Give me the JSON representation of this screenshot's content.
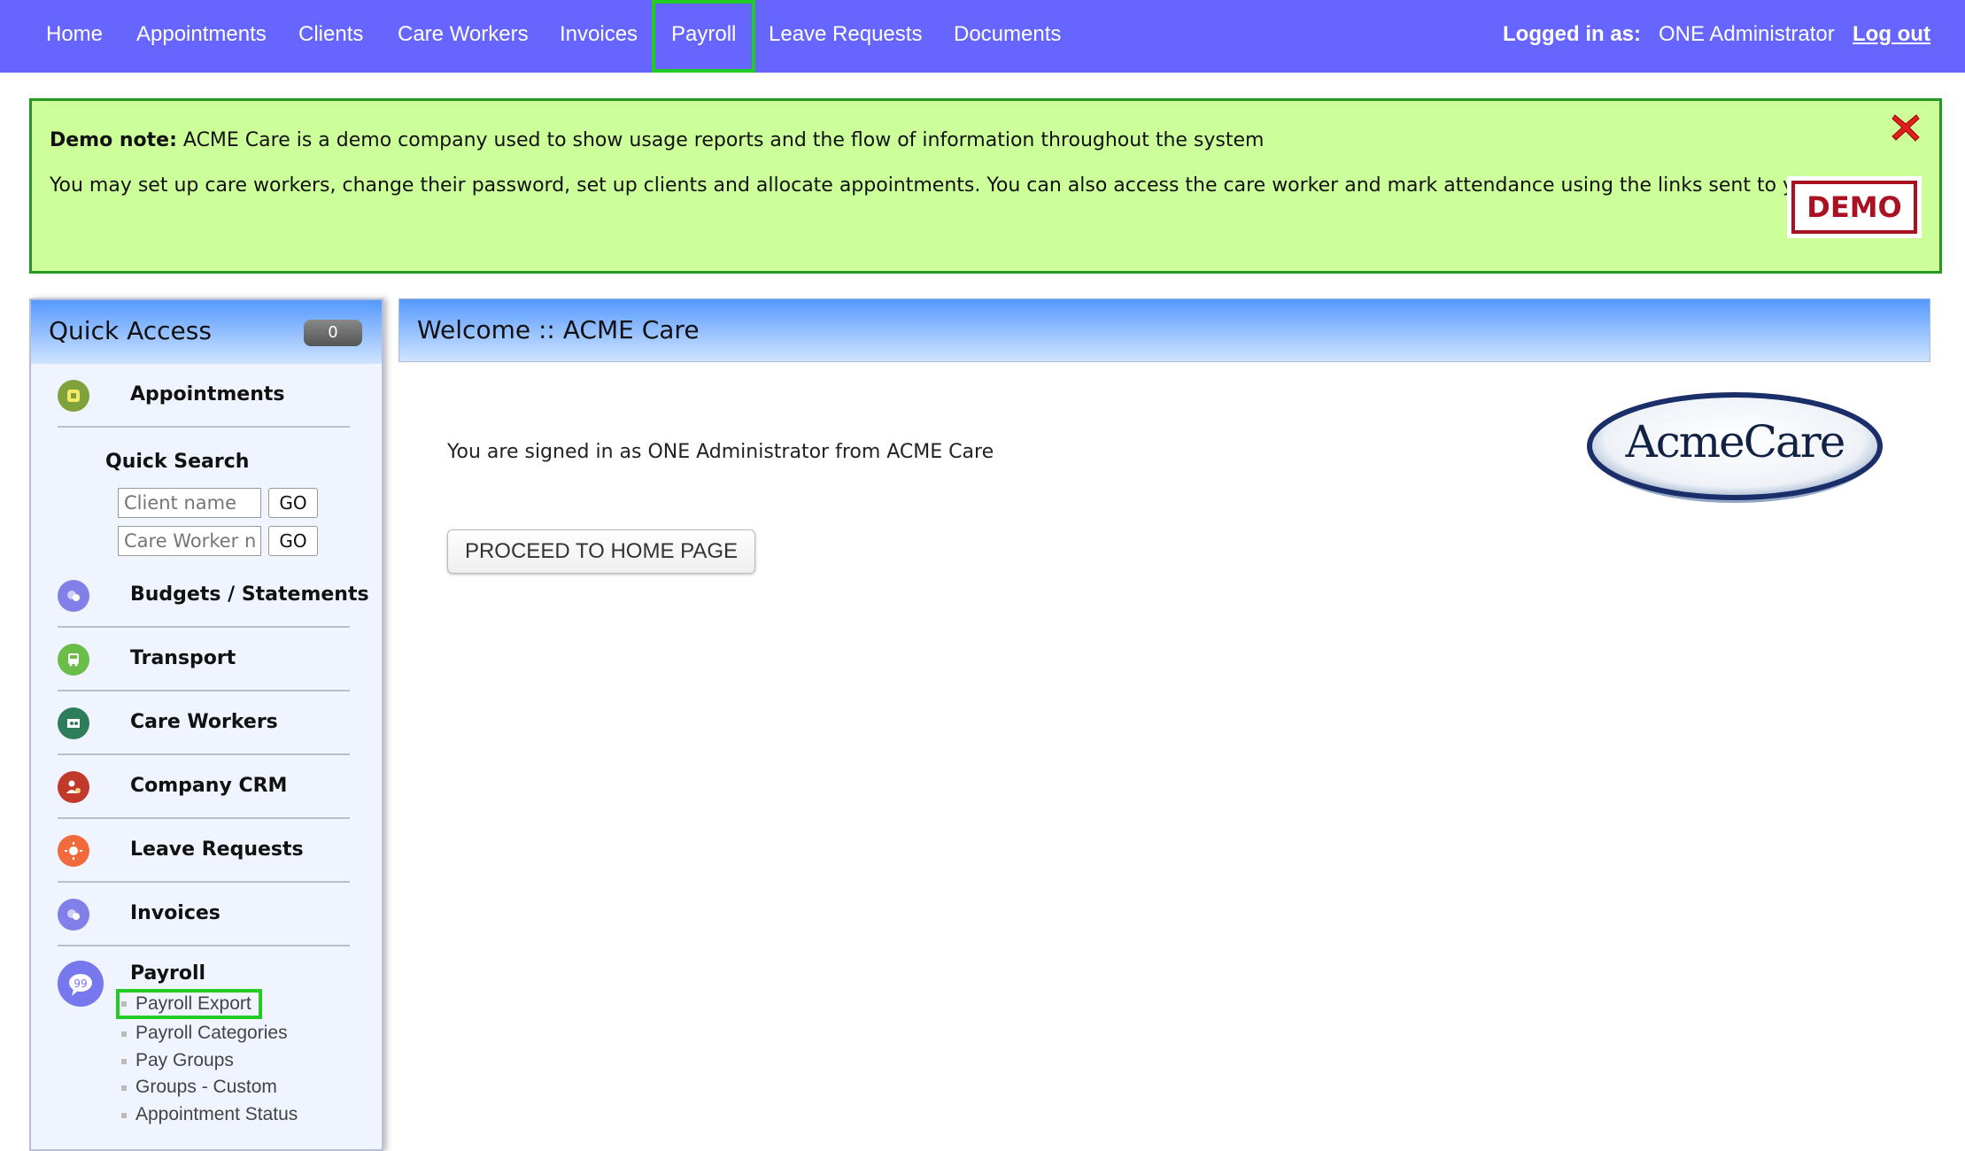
{
  "nav": {
    "items": [
      "Home",
      "Appointments",
      "Clients",
      "Care Workers",
      "Invoices",
      "Payroll",
      "Leave Requests",
      "Documents"
    ],
    "active": "Payroll",
    "logged_in_label": "Logged in as:",
    "user_name": "ONE Administrator",
    "logout_label": "Log out"
  },
  "demo_note": {
    "label": "Demo note:",
    "line1": "ACME Care is a demo company used to show usage reports and the flow of information throughout the system",
    "line2": "You may set up care workers, change their password, set up clients and allocate appointments. You can also access the care worker and mark attendance using the links sent to you.",
    "stamp": "DEMO"
  },
  "sidebar": {
    "title": "Quick Access",
    "count": "0",
    "items": [
      {
        "label": "Appointments",
        "icon": "appointments-icon",
        "color": "#7fa23a"
      },
      {
        "label": "Budgets / Statements",
        "icon": "budgets-icon",
        "color": "#8080e8"
      },
      {
        "label": "Transport",
        "icon": "bus-icon",
        "color": "#6bbd4a"
      },
      {
        "label": "Care Workers",
        "icon": "care-workers-icon",
        "color": "#2e7d5a"
      },
      {
        "label": "Company CRM",
        "icon": "crm-icon",
        "color": "#c0392b"
      },
      {
        "label": "Leave Requests",
        "icon": "sun-icon",
        "color": "#f06a3c"
      },
      {
        "label": "Invoices",
        "icon": "invoices-icon",
        "color": "#8080e8"
      }
    ],
    "quick_search": {
      "title": "Quick Search",
      "client_placeholder": "Client name",
      "worker_placeholder": "Care Worker name",
      "go_label": "GO"
    },
    "payroll": {
      "label": "Payroll",
      "subitems": [
        "Payroll Export",
        "Payroll Categories",
        "Pay Groups",
        "Groups - Custom",
        "Appointment Status"
      ]
    }
  },
  "main": {
    "title": "Welcome :: ACME Care",
    "signed_in_text": "You are signed in as ONE Administrator from ACME Care",
    "proceed_label": "PROCEED TO HOME PAGE",
    "logo_text": "AcmeCare"
  }
}
